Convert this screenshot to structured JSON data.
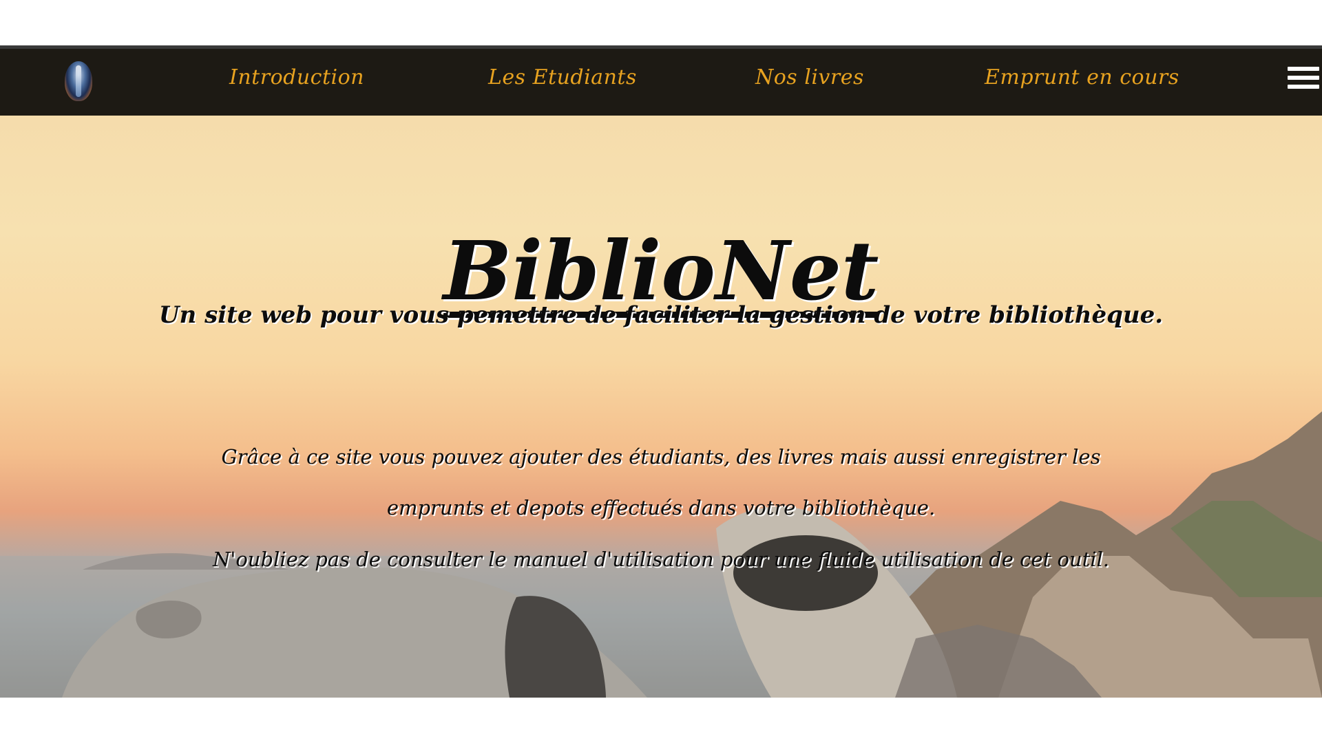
{
  "nav": {
    "logo_icon": "biblionet-logo-icon",
    "items": [
      {
        "label": "Introduction"
      },
      {
        "label": "Les Etudiants"
      },
      {
        "label": "Nos livres"
      },
      {
        "label": "Emprunt en cours"
      }
    ],
    "menu_icon": "hamburger-menu-icon"
  },
  "hero": {
    "title": "BiblioNet",
    "subtitle": "Un site web pour vous pemettre de faciliter la gestion de votre bibliothèque.",
    "paragraph_lines": [
      "Grâce à ce site vous pouvez ajouter des étudiants, des livres mais aussi enregistrer les",
      "emprunts et depots effectués dans votre bibliothèque.",
      "N'oubliez pas de consulter le manuel d'utilisation pour une fluide utilisation de cet outil."
    ],
    "background": "sunset-coastal-rocks-image"
  },
  "colors": {
    "nav_background": "#1d1a14",
    "nav_link": "#e7a220",
    "text": "#0c0c0c",
    "text_shadow": "#ffffff"
  }
}
